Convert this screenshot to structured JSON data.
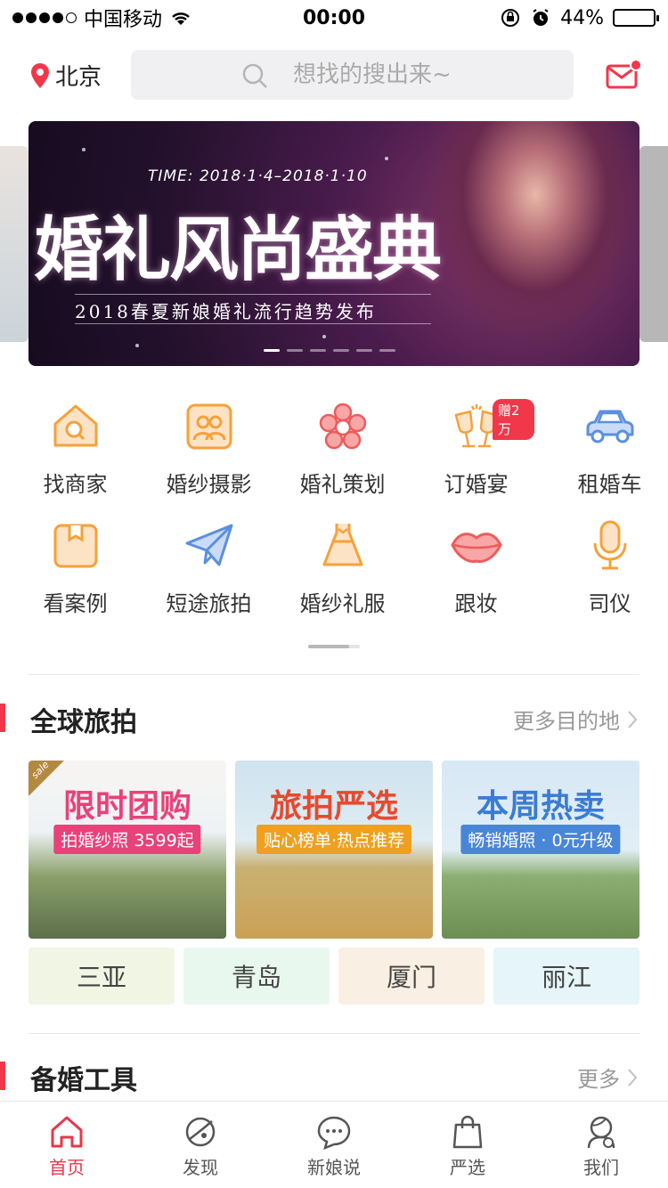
{
  "status_bar": {
    "carrier": "中国移动",
    "time": "00:00",
    "battery": "44%",
    "battery_level": 0.44
  },
  "header": {
    "city": "北京",
    "search_placeholder": "想找的搜出来~"
  },
  "banner": {
    "time": "TIME: 2018·1·4–2018·1·10",
    "title": "婚礼风尚盛典",
    "subtitle": "2018春夏新娘婚礼流行趋势发布",
    "page_count": 6,
    "active_page": 1
  },
  "categories": [
    {
      "label": "找商家",
      "icon": "house-search-icon"
    },
    {
      "label": "婚纱摄影",
      "icon": "photo-people-icon"
    },
    {
      "label": "婚礼策划",
      "icon": "flower-icon"
    },
    {
      "label": "订婚宴",
      "icon": "wine-glasses-icon",
      "badge": "赠2万"
    },
    {
      "label": "租婚车",
      "icon": "car-icon"
    },
    {
      "label": "看案例",
      "icon": "case-box-icon"
    },
    {
      "label": "短途旅拍",
      "icon": "paper-plane-icon"
    },
    {
      "label": "婚纱礼服",
      "icon": "dress-icon"
    },
    {
      "label": "跟妆",
      "icon": "lips-icon"
    },
    {
      "label": "司仪",
      "icon": "microphone-icon"
    }
  ],
  "travel": {
    "title": "全球旅拍",
    "more": "更多目的地",
    "cards": [
      {
        "title": "限时团购",
        "subtitle": "拍婚纱照 3599起",
        "tag": "sale",
        "title_color": "#e8427a",
        "sub_bg": "#e8427a"
      },
      {
        "title": "旅拍严选",
        "subtitle": "贴心榜单·热点推荐",
        "title_color": "#e64a2e",
        "sub_bg": "#f0a020"
      },
      {
        "title": "本周热卖",
        "subtitle": "畅销婚照 · 0元升级",
        "title_color": "#3a7cd4",
        "sub_bg": "#4a86d8"
      }
    ],
    "cities": [
      {
        "name": "三亚",
        "bg": "#f1f6e4"
      },
      {
        "name": "青岛",
        "bg": "#e8f8ee"
      },
      {
        "name": "厦门",
        "bg": "#f9efe2"
      },
      {
        "name": "丽江",
        "bg": "#e5f5f9"
      }
    ]
  },
  "tools": {
    "title": "备婚工具",
    "more": "更多"
  },
  "tabbar": [
    {
      "label": "首页",
      "icon": "home-icon",
      "active": true
    },
    {
      "label": "发现",
      "icon": "planet-icon"
    },
    {
      "label": "新娘说",
      "icon": "chat-bubble-icon"
    },
    {
      "label": "严选",
      "icon": "shopping-bag-icon"
    },
    {
      "label": "我们",
      "icon": "couple-icon"
    }
  ],
  "colors": {
    "accent": "#f2374b",
    "icon_orange": "#f5a13a",
    "icon_red": "#ee5b5b",
    "icon_blue": "#5b8fe0"
  }
}
